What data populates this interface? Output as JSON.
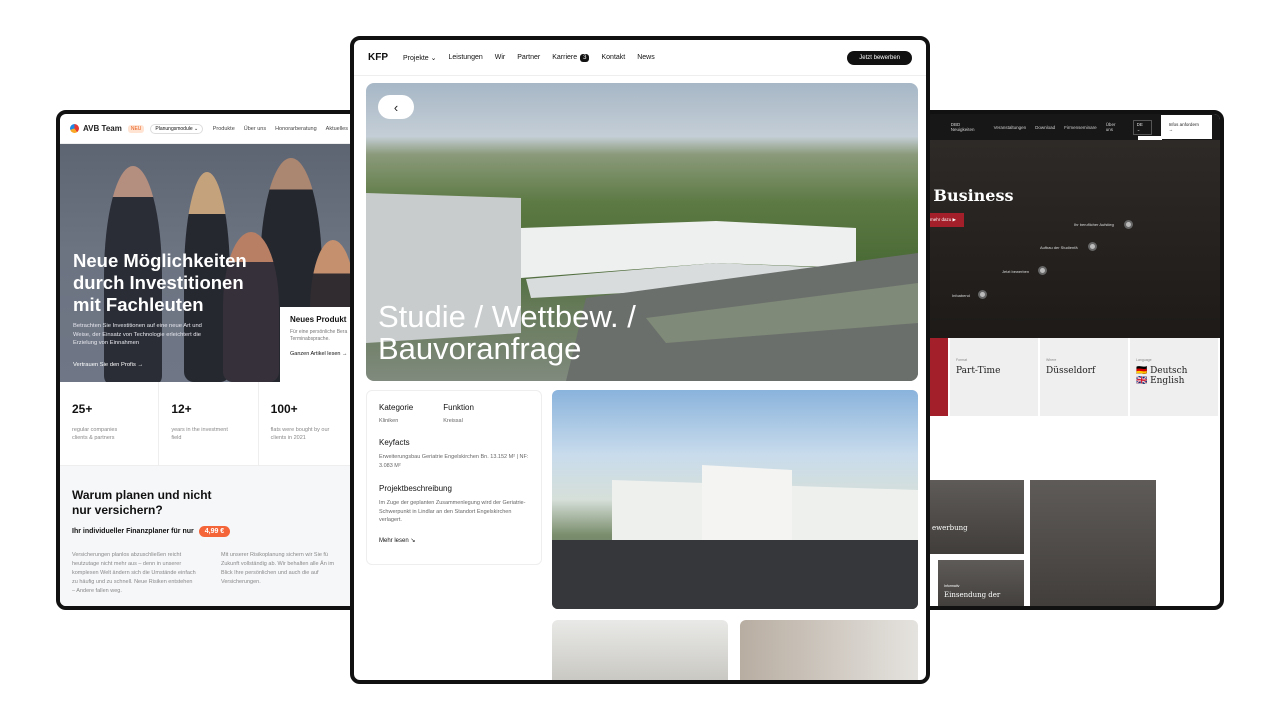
{
  "left": {
    "brand": "AVB Team",
    "badge": "NEU",
    "planner": "Planungsmodule",
    "menu": [
      "Produkte",
      "Über uns",
      "Honorarberatung",
      "Aktuelles"
    ],
    "hero": {
      "title": "Neue Möglichkeiten durch Investitionen mit Fachleuten",
      "description": "Betrachten Sie Investitionen auf eine neue Art und Weise, der Einsatz von Technologie erleichtert die Erzielung von Einnahmen",
      "link": "Vertrauen Sie den Profis →"
    },
    "news": {
      "title": "Neues Produkt",
      "description": "Für eine persönliche Bera Terminabsprache.",
      "link": "Ganzen Artikel lesen →"
    },
    "stats": [
      {
        "number": "25+",
        "caption": "regular companies clients & partners"
      },
      {
        "number": "12+",
        "caption": "years in the investment field"
      },
      {
        "number": "100+",
        "caption": "flats were bought by our clients in 2021"
      }
    ],
    "why": {
      "title": "Warum planen und nicht nur versichern?",
      "subtitle": "Ihr individueller Finanzplaner für nur",
      "price": "4,99 €",
      "col1": "Versicherungen planlos abzuschließen reicht heutzutage nicht mehr aus – denn in unserer komplexen Welt ändern sich die Umstände einfach zu häufig und zu schnell. Neue Risiken entstehen – Andere fallen weg.",
      "col2": "Mit unserer Risikoplanung sichern wir Sie fü Zukunft vollständig ab. Wir behalten alle Än im Blick Ihre persönlichen und auch die auf Versicherungen."
    }
  },
  "center": {
    "brand": "KFP",
    "menu": [
      "Projekte ⌄",
      "Leistungen",
      "Wir",
      "Partner",
      "Karriere",
      "Kontakt",
      "News"
    ],
    "career_count": "3",
    "apply": "Jetzt bewerben",
    "back_icon": "chevron-left-icon",
    "hero_title": "Studie / Wettbew. / Bauvoranfrage",
    "info": {
      "kategorie_label": "Kategorie",
      "kategorie_value": "Kliniken",
      "funktion_label": "Funktion",
      "funktion_value": "Kreissal",
      "keyfacts_label": "Keyfacts",
      "keyfacts_value": "Erweiterungsbau Geriatrie Engelskirchen Bn. 13.152 M² | NF: 3.083 M²",
      "beschreibung_label": "Projektbeschreibung",
      "beschreibung_value": "Im Zuge der geplanten Zusammenlegung wird der Geriatrie-Schwerpunkt in Lindlar an den Standort Engelskirchen verlagert.",
      "more": "Mehr lesen ↘"
    }
  },
  "right": {
    "menu": [
      "DBD Neuigkeiten",
      "Veranstaltungen",
      "Download",
      "Firmenseminare",
      "Über uns"
    ],
    "lang_select": "DE ⌄",
    "languages": [
      "DE",
      "EN"
    ],
    "offer": "Infos anfordern →",
    "title": "Business",
    "red_button": "mehr dazu ▶",
    "nodes": [
      "Ihr beruflicher Aufstieg",
      "Aufbau der Studienfä",
      "Jetzt bewerben",
      "Infoabend"
    ],
    "tiles": [
      {
        "small": "Format",
        "value": "Part-Time"
      },
      {
        "small": "Where",
        "value": "Düsseldorf"
      },
      {
        "small": "Language",
        "value": "🇩🇪 Deutsch\n🇬🇧 English"
      }
    ],
    "photo1": "ewerbung",
    "photo2_small": "Informativ",
    "photo2": "Einsendung der"
  }
}
